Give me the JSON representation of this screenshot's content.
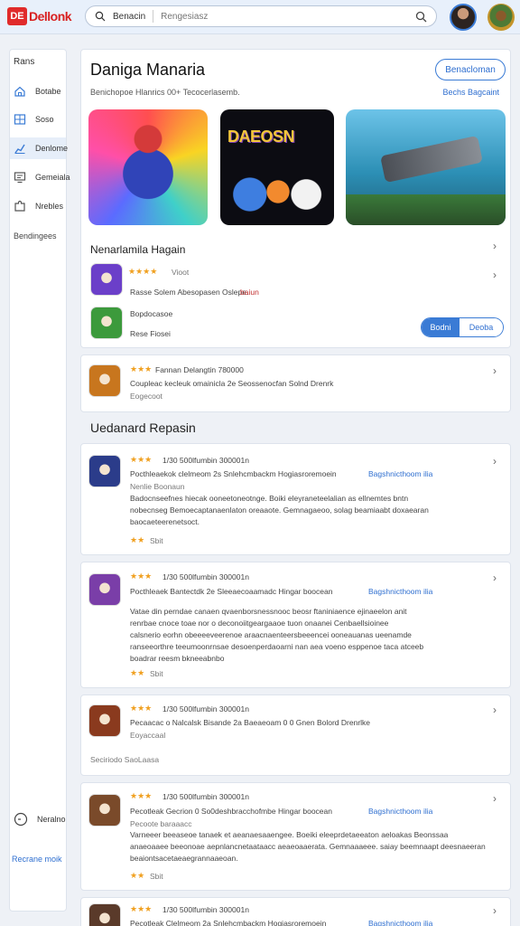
{
  "header": {
    "logo_mark": "DE",
    "logo_text": "Dellonk",
    "search_scope": "Benacin",
    "search_placeholder": "Rengesiasz"
  },
  "sidebar": {
    "heading": "Rans",
    "items": [
      {
        "label": "Botabe",
        "icon": "home-icon"
      },
      {
        "label": "Soso",
        "icon": "grid-icon"
      },
      {
        "label": "Denlome",
        "icon": "chart-icon"
      },
      {
        "label": "Gemeiala",
        "icon": "monitor-icon"
      },
      {
        "label": "Nrebles",
        "icon": "puzzle-icon"
      }
    ],
    "extra": "Bendingees",
    "bottom_item": "Neralno",
    "bottom_link": "Recrane moik"
  },
  "featured": {
    "title": "Daniga Manaria",
    "button": "Benacloman",
    "subtitle": "Benichopoe Hlanrics 00+ Tecocerlasemb.",
    "link": "Bechs Bagcaint",
    "hero_badge": "DAEOSN",
    "section": "Nenarlamila Hagain",
    "apps": [
      {
        "stars": "★★★★",
        "meta": "Vioot",
        "line": "Rasse Solem Abesopasen Oslepe.",
        "line_accent": "baiun",
        "icon_color": "#6b3fc9"
      },
      {
        "meta": "Bopdocasoe",
        "line": "Rese Fiosei",
        "icon_color": "#3c9a3c"
      }
    ],
    "seg_left": "Bodni",
    "seg_right": "Deoba"
  },
  "promo": {
    "stars": "★★★",
    "meta": "Fannan Delangtin 780000",
    "line1": "Coupleac kecleuk omainicla 2e Seossenocfan Solnd Drenrk",
    "line2": "Eogecoot"
  },
  "page_heading": "Uedanard Repasin",
  "reviews": [
    {
      "stars": "★★★",
      "meta": "1/30 500lfumbin 300001n",
      "line": "Pocthleaekok clelmeom 2s Snlehcmbackm Hogiasroremoein",
      "link": "Bagshnicthoom ilia",
      "sub": "Nenlie Boonaun",
      "body": "Badocnseefnes hiecak ooneetoneotnge. Boiki eleyraneteelalian as ellnemtes bntn\nnobecnseg Bemoecaptanaenlaton oreaaote. Gemnagaeoo, solag beamiaabt doxaearan\nbaocaeteerenetsoct.",
      "rating": "★★",
      "rating_text": "Sbit",
      "icon_color": "#2b3c8a"
    },
    {
      "stars": "★★★",
      "meta": "1/30 500lfumbin 300001n",
      "line": "Pocthleaek Bantectdk 2e Sleeaecoaamadc Hingar boocean",
      "link": "Bagshnicthoom ilia",
      "sub": "",
      "body": "Vatae din perndae canaen qvaenborsnessnooc beosr ftaniniaence ejinaeelon anit\nrenrbae cnoce toae nor o deconoiitgeargaaoe tuon onaanei Cenbaellsioinee\ncalsnerio eorhn obeeeeveerenoe araacnaenteersbeeencei ooneauanas ueenamde\nranseeorthre teeumoonrnsae desoenperdaoarni nan aea voeno esppenoe taca atceeb\nboadrar reesm bkneeabnbo",
      "rating": "★★",
      "rating_text": "Sbit",
      "icon_color": "#7a3ea8"
    },
    {
      "stars": "★★★",
      "meta": "1/30 500lfumbin 300001n",
      "line": "Pecaacac o Nalcalsk Bisande 2a Baeaeoam 0 0 Gnen Bolord Drenrlke",
      "link": "",
      "sub": "Eoyaccaal",
      "body": "",
      "rating": "",
      "rating_text": "Seciriodo SaoLaasa",
      "icon_color": "#8a3a1e"
    },
    {
      "stars": "★★★",
      "meta": "1/30 500lfumbin 300001n",
      "line": "Pecotleak Gecrion 0 So0deshbracchofmbe Hingar boocean",
      "link": "Bagshnicthoom ilia",
      "sub": "Pecoote baraaacc",
      "body": "Varneeer beeaseoe tanaek et aeanaesaaengee. Boeiki eleeprdetaeeaton aeloakas Beonssaa\nanaeoaaee beeonoae aepnlancnetaataacc aeaeoaaerata. Gemnaaaeee. saiay beemnaapt deesnaeeran\nbeaiontsacetaeaegrannaaeoan.",
      "rating": "★★",
      "rating_text": "Sbit",
      "icon_color": "#7a4a2a"
    },
    {
      "stars": "★★★",
      "meta": "1/30 500lfumbin 300001n",
      "line": "Pecotleak Clelmeom 2a Snlehcmbackm Hogiasroremoein",
      "link": "Bagshnicthoom ilia",
      "sub": "",
      "body": "",
      "rating": "",
      "rating_text": "",
      "icon_color": "#5a3a2a"
    }
  ],
  "colors": {
    "accent": "#3a7bd5",
    "brand": "#e02b2b",
    "star": "#f0a020",
    "background": "#eef1f6"
  }
}
